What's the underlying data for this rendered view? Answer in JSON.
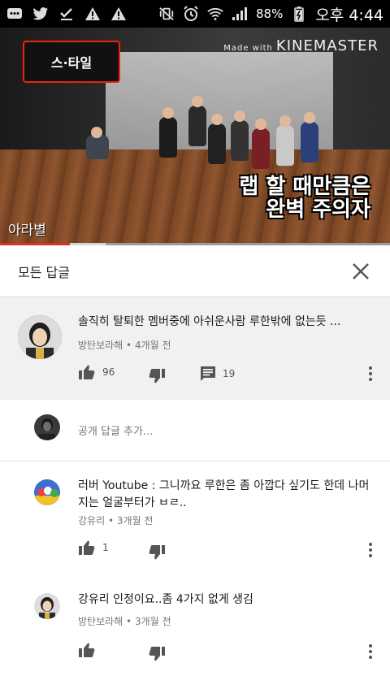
{
  "status_bar": {
    "battery": "88%",
    "time": "오후 4:44"
  },
  "video": {
    "watermark_prefix": "Made with",
    "watermark": "KINEMASTER",
    "show_logo": "스·타일",
    "caption_line1": "랩 할 때만큼은",
    "caption_line2": "완벽 주의자",
    "channel": "아라별",
    "played_fraction": 0.18,
    "buffered_fraction": 0.27
  },
  "replies_panel": {
    "title": "모든 답글"
  },
  "parent_comment": {
    "text": "솔직히 탈퇴한 멤버중에 아쉬운사람 루한밖에 없는듯 ...",
    "author": "방탄보라해",
    "time": "4개월 전",
    "likes": "96",
    "replies": "19"
  },
  "add_reply": {
    "placeholder": "공개 답글 추가..."
  },
  "replies": [
    {
      "text": "러버 Youtube : 그니까요 루한은 좀 아깝다 싶기도 한데 나머지는 얼굴부터가 ㅂㄹ..",
      "author": "강유리",
      "time": "3개월 전",
      "likes": "1"
    },
    {
      "text": "강유리 인정이요..좀 4가지 없게 생김",
      "author": "방탄보라해",
      "time": "3개월 전",
      "likes": ""
    }
  ]
}
